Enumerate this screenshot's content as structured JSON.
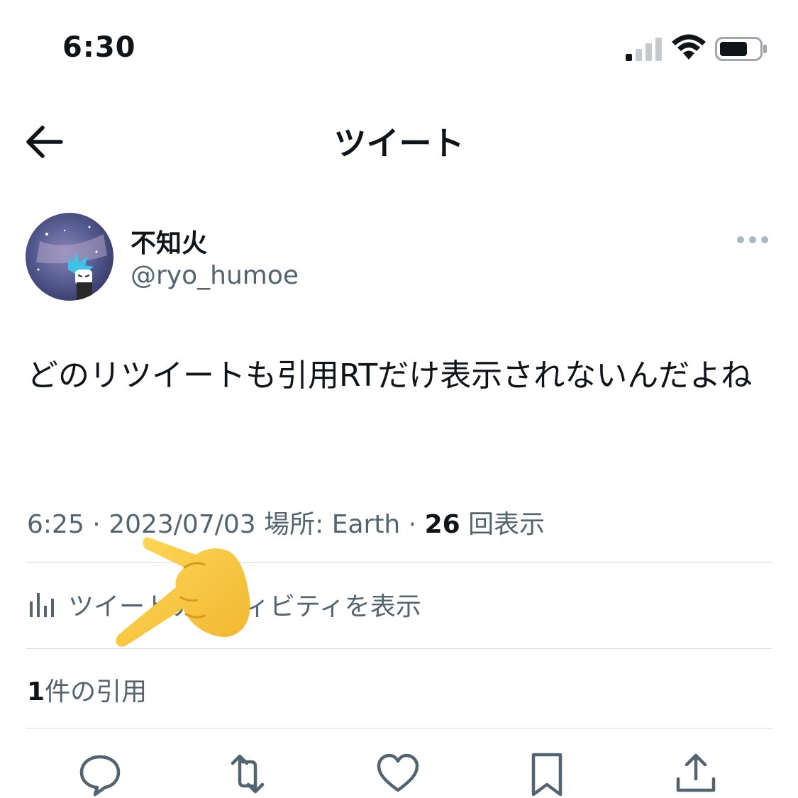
{
  "status_bar": {
    "time": "6:30"
  },
  "header": {
    "title": "ツイート"
  },
  "tweet": {
    "author": {
      "display_name": "不知火",
      "handle": "@ryo_humoe"
    },
    "text": "どのリツイートも引用RTだけ表示されないんだよね",
    "meta": {
      "time": "6:25",
      "separator": " · ",
      "date": "2023/07/03",
      "location_label": "場所: Earth",
      "views_count": "26",
      "views_label": "回表示"
    },
    "activity_label": "ツイートアクティビティを表示",
    "quotes": {
      "count": "1",
      "label": "件の引用"
    }
  },
  "actions": {
    "items": [
      "reply-icon",
      "retweet-icon",
      "like-icon",
      "bookmark-icon",
      "share-icon"
    ]
  },
  "colors": {
    "text_primary": "#0f1419",
    "text_secondary": "#536471",
    "divider": "#cfd9de",
    "emoji_yellow": "#f5c33b"
  }
}
